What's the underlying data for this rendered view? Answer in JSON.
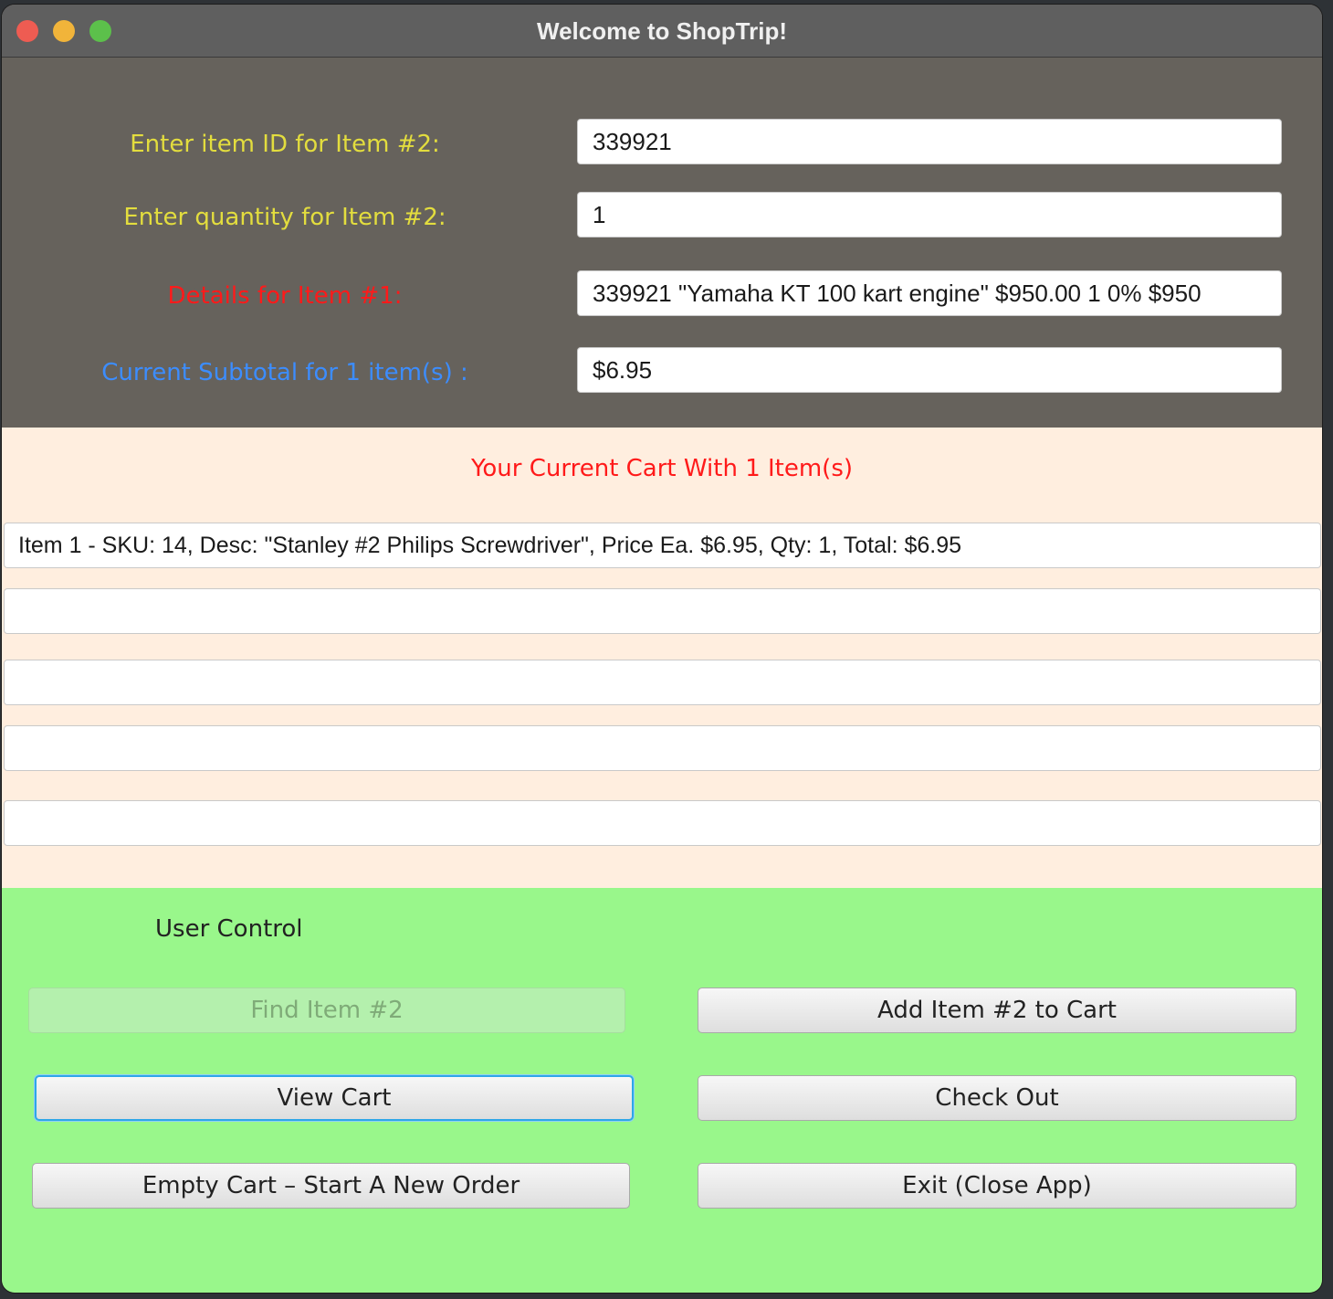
{
  "window": {
    "title": "Welcome to ShopTrip!"
  },
  "form": {
    "item_id_label": "Enter item ID for Item #2:",
    "item_id_value": "339921",
    "quantity_label": "Enter quantity for Item #2:",
    "quantity_value": "1",
    "details_label": "Details for Item #1:",
    "details_value": "339921 \"Yamaha KT 100 kart engine\" $950.00 1 0% $950",
    "subtotal_label": "Current Subtotal for 1 item(s) :",
    "subtotal_value": "$6.95"
  },
  "cart": {
    "heading": "Your Current Cart With 1 Item(s)",
    "lines": [
      "Item 1 - SKU: 14, Desc: \"Stanley #2 Philips Screwdriver\", Price Ea. $6.95, Qty: 1, Total: $6.95",
      "",
      "",
      "",
      ""
    ]
  },
  "controls": {
    "heading": "User Control",
    "find_item": "Find Item #2",
    "add_item": "Add Item #2 to Cart",
    "view_cart": "View Cart",
    "check_out": "Check Out",
    "empty_cart": "Empty Cart – Start A New Order",
    "exit": "Exit (Close App)"
  },
  "colors": {
    "top_panel": "#66625c",
    "cart_panel": "#ffeedf",
    "control_panel": "#99f78b",
    "label_yellow": "#e3dd3e",
    "label_red": "#ff1a1a",
    "label_blue": "#3c8dff"
  }
}
